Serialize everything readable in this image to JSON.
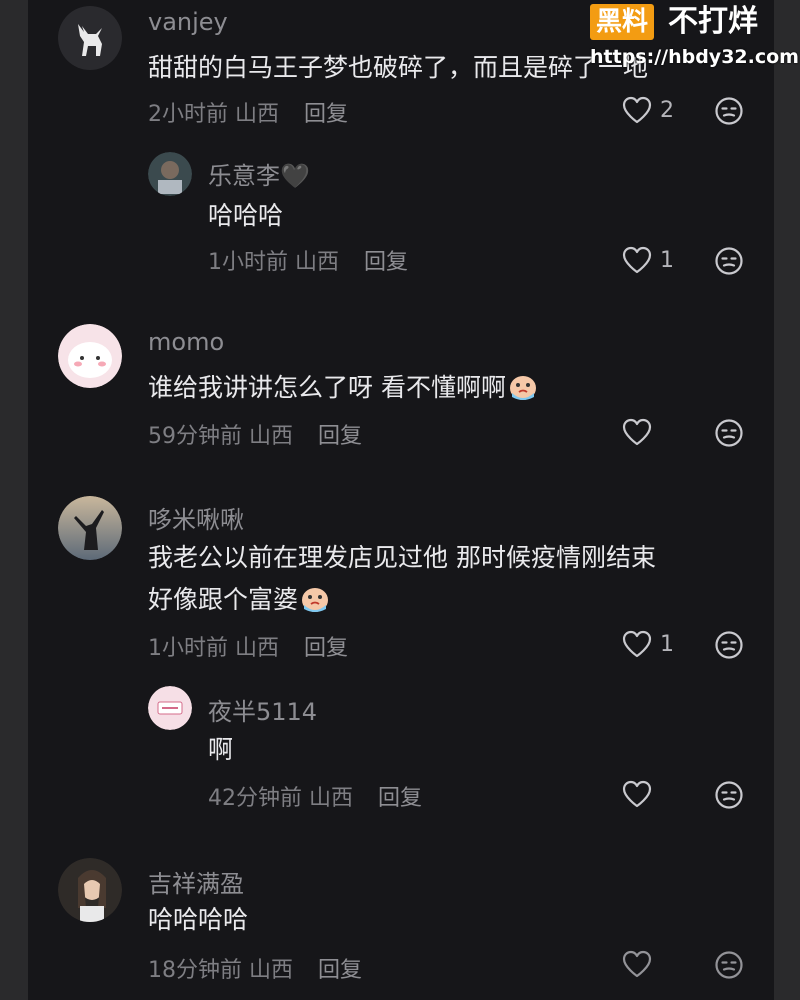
{
  "watermark": {
    "logo": "黑料",
    "slogan": "不打烊",
    "url": "https://hbdy32.com"
  },
  "comments": [
    {
      "username": "vanjey",
      "text": "甜甜的白马王子梦也破碎了，而且是碎了一地",
      "time": "2小时前",
      "location": "山西",
      "reply_label": "回复",
      "likes": "2"
    },
    {
      "username": "乐意李🖤",
      "text": "哈哈哈",
      "time": "1小时前",
      "location": "山西",
      "reply_label": "回复",
      "likes": "1"
    },
    {
      "username": "momo",
      "text": "谁给我讲讲怎么了呀 看不懂啊啊",
      "time": "59分钟前",
      "location": "山西",
      "reply_label": "回复",
      "likes": ""
    },
    {
      "username": "哆米啾啾",
      "text_line1": "我老公以前在理发店见过他   那时候疫情刚结束",
      "text_line2": "好像跟个富婆",
      "time": "1小时前",
      "location": "山西",
      "reply_label": "回复",
      "likes": "1"
    },
    {
      "username": "夜半5114",
      "text": "啊",
      "time": "42分钟前",
      "location": "山西",
      "reply_label": "回复",
      "likes": ""
    },
    {
      "username": "吉祥满盈",
      "text": "哈哈哈哈",
      "time": "18分钟前",
      "location": "山西",
      "reply_label": "回复",
      "likes": ""
    }
  ],
  "icons": {
    "like": "heart-outline-icon",
    "dislike": "unamused-face-icon",
    "emoji_cry": "crying-emoji-icon"
  },
  "colors": {
    "background": "#161619",
    "text": "#e9e9ec",
    "meta": "#7e7e83",
    "watermark_orange": "#f39c12"
  }
}
